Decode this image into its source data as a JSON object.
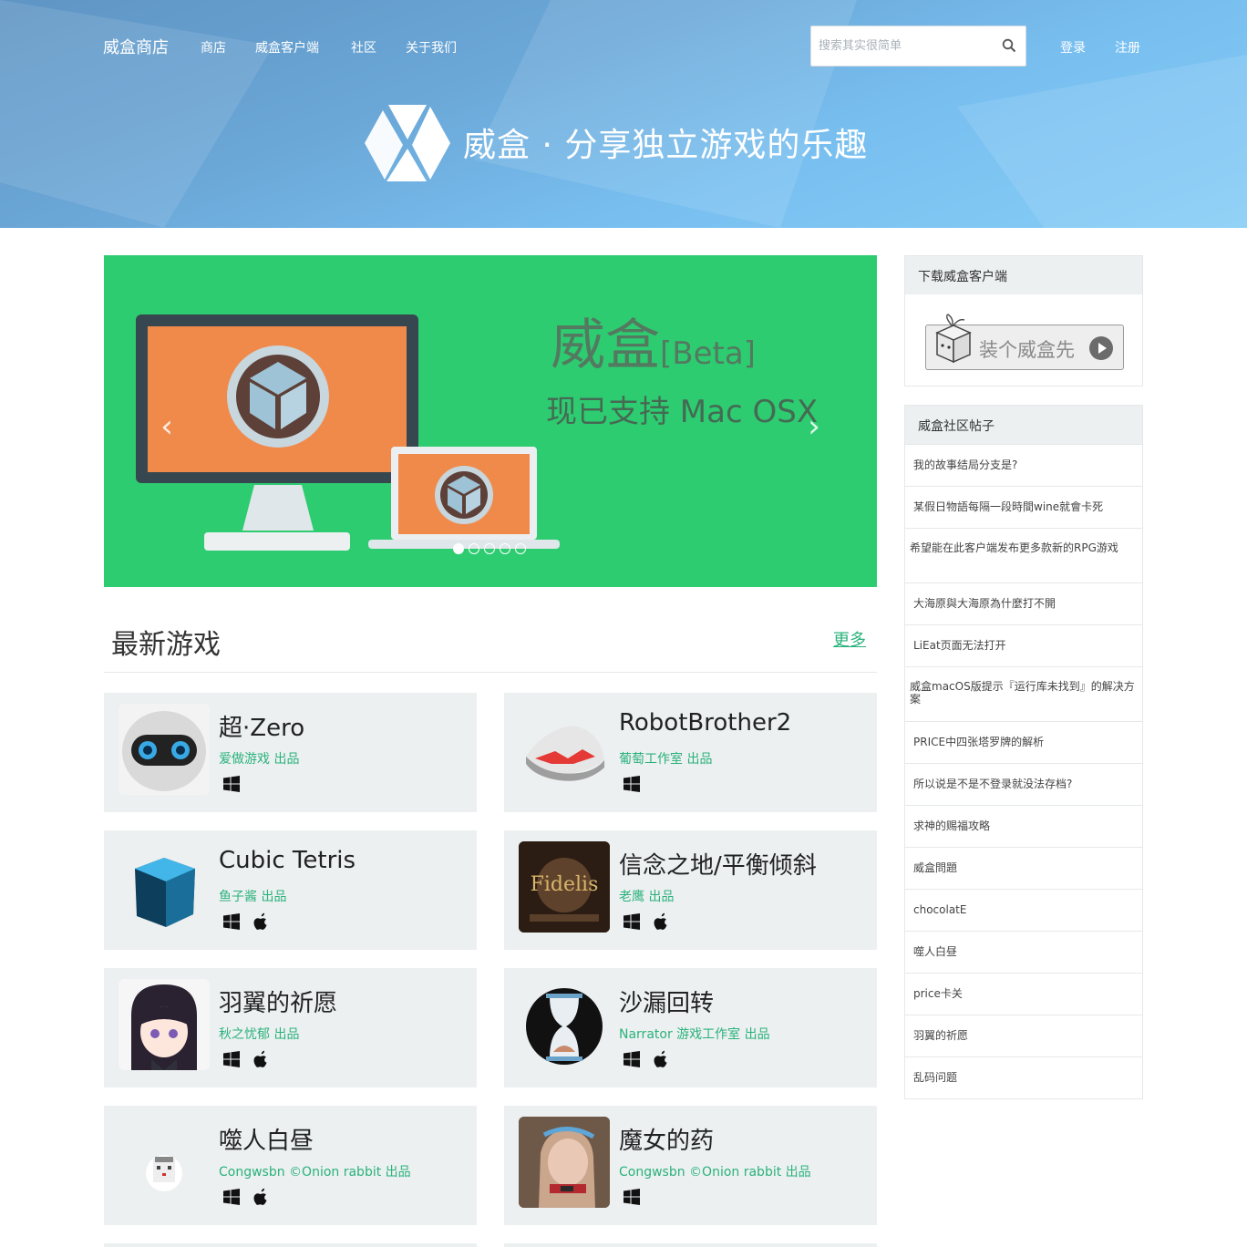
{
  "nav": {
    "brand": "威盒商店",
    "links": [
      "商店",
      "威盒客户端",
      "社区",
      "关于我们"
    ],
    "search_placeholder": "搜索其实很简单",
    "login": "登录",
    "register": "注册"
  },
  "hero": {
    "title": "威盒 · 分享独立游戏的乐趣"
  },
  "carousel": {
    "title": "威盒",
    "title_suffix": "[Beta]",
    "subtitle": "现已支持 Mac OSX",
    "prev": "‹",
    "next": "›",
    "slide_count": 5,
    "active_slide": 1
  },
  "latest": {
    "title": "最新游戏",
    "more": "更多",
    "games": [
      {
        "title": "超·Zero",
        "author": "爱做游戏 出品",
        "platforms": [
          "windows"
        ]
      },
      {
        "title": "RobotBrother2",
        "author": "葡萄工作室 出品",
        "platforms": [
          "windows"
        ]
      },
      {
        "title": "Cubic Tetris",
        "author": "鱼子酱 出品",
        "platforms": [
          "windows",
          "apple"
        ]
      },
      {
        "title": "信念之地/平衡倾斜",
        "author": "老鹰 出品",
        "platforms": [
          "windows",
          "apple"
        ]
      },
      {
        "title": "羽翼的祈愿",
        "author": "秋之忧郁 出品",
        "platforms": [
          "windows",
          "apple"
        ]
      },
      {
        "title": "沙漏回转",
        "author": "Narrator 游戏工作室 出品",
        "platforms": [
          "windows",
          "apple"
        ]
      },
      {
        "title": "噬人白昼",
        "author": "Congwsbn ©Onion rabbit 出品",
        "platforms": [
          "windows",
          "apple"
        ]
      },
      {
        "title": "魔女的药",
        "author": "Congwsbn ©Onion rabbit 出品",
        "platforms": [
          "windows"
        ]
      }
    ]
  },
  "sidebar": {
    "download": {
      "title": "下载威盒客户端",
      "button": "装个威盒先"
    },
    "posts": {
      "title": "威盒社区帖子",
      "items": [
        "我的故事结局分支是?",
        "某假日物語每隔一段時間wine就會卡死",
        "希望能在此客户端发布更多款新的RPG游戏",
        "大海原與大海原為什麼打不開",
        "LiEat页面无法打开",
        "威盒macOS版提示『运行库未找到』的解决方案",
        "PRICE中四张塔罗牌的解析",
        "所以说是不是不登录就没法存档?",
        "求神的赐福攻略",
        "威盒問題",
        "chocolatE",
        "噬人白昼",
        "price卡关",
        "羽翼的祈愿",
        "乱码问题"
      ]
    }
  }
}
